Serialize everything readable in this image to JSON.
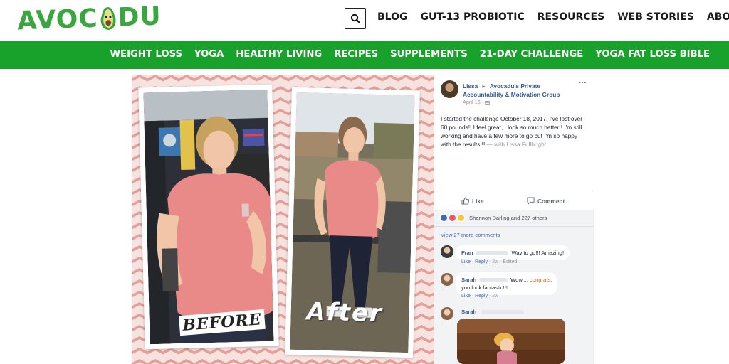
{
  "site": {
    "logo_left": "AVOC",
    "logo_right": "DU",
    "brand_green": "#3aa640"
  },
  "top_nav": {
    "search_icon": "search-icon",
    "items": [
      "BLOG",
      "GUT-13 PROBIOTIC",
      "RESOURCES",
      "WEB STORIES",
      "ABOUT"
    ]
  },
  "green_nav": {
    "color": "#18a22b",
    "items": [
      "WEIGHT LOSS",
      "YOGA",
      "HEALTHY LIVING",
      "RECIPES",
      "SUPPLEMENTS",
      "21-DAY CHALLENGE",
      "YOGA FAT LOSS BIBLE"
    ]
  },
  "hero": {
    "before_label": "BEFORE",
    "after_label": "After"
  },
  "post": {
    "author": "Lissa",
    "arrow": "▸",
    "group": "Avocadu's Private Accountability & Motivation Group",
    "date": "April 16 · ",
    "text": "I started the challenge October 18, 2017, I've lost over 60 pounds!! I feel great, I look so much better!! I'm still working and have a few more to go but I'm so happy with the results!!!",
    "with_text": " — with Lissa Fullbright.",
    "like_label": "Like",
    "comment_label": "Comment",
    "reactions_text": "Shannon Darling and 227 others",
    "view_more": "View 27 more comments"
  },
  "comments": [
    {
      "name": "Fran",
      "text": "Way to go!!! Amazing!",
      "like": "Like",
      "reply": "Reply",
      "time": "2w",
      "edited": "Edited"
    },
    {
      "name": "Sarah",
      "text_before": "Wow.... ",
      "highlight": "congrats",
      "text_after": ",",
      "text_line2": "you look fantastic!!!",
      "like": "Like",
      "reply": "Reply",
      "time": "2w"
    },
    {
      "name": "Sarah"
    }
  ]
}
